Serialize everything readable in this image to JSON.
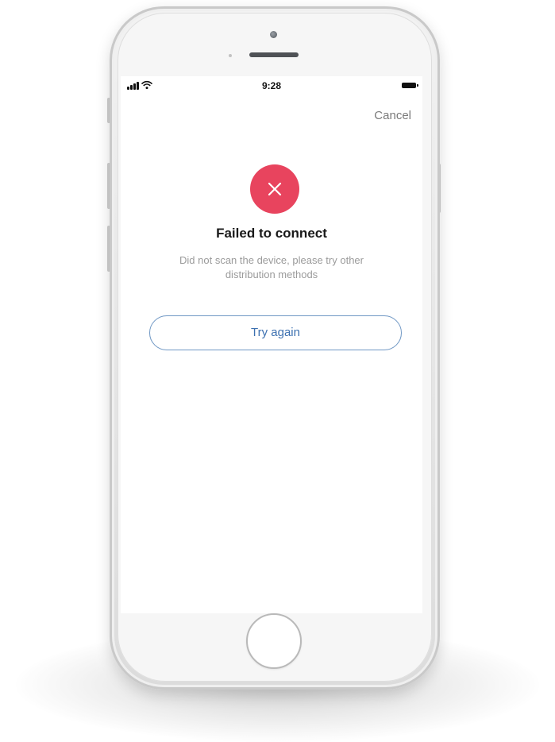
{
  "status_bar": {
    "time": "9:28",
    "signal_icon": "signal-bars-icon",
    "wifi_icon": "wifi-icon",
    "battery_icon": "battery-icon"
  },
  "header": {
    "cancel_label": "Cancel"
  },
  "result": {
    "status_icon": "error-x-icon",
    "title": "Failed to connect",
    "message": "Did not scan the device, please try other distribution methods"
  },
  "actions": {
    "retry_label": "Try again"
  },
  "colors": {
    "error": "#e8445e",
    "button_text": "#3c70b0",
    "button_border": "#6f97c4",
    "secondary_text": "#9b9b9b"
  }
}
